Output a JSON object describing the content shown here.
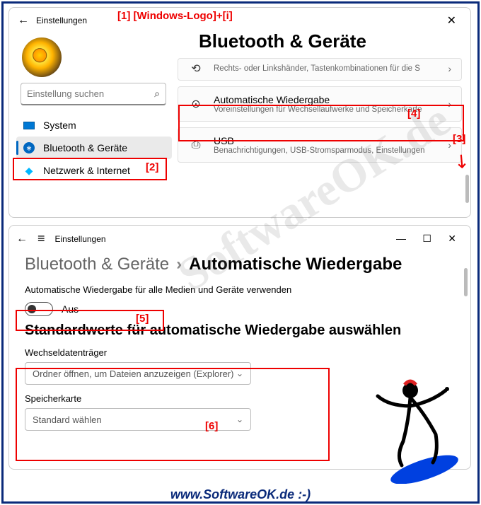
{
  "annot1": "[1]  [Windows-Logo]+[i]",
  "annot2": "[2]",
  "annot3": "[3]",
  "annot4": "[4]",
  "annot5": "[5]",
  "annot6": "[6]",
  "watermark": "SoftwareOK.de",
  "footer": "www.SoftwareOK.de :-)",
  "win1": {
    "back": "←",
    "title": "Einstellungen",
    "close": "✕",
    "pageTitle": "Bluetooth & Geräte",
    "searchPlaceholder": "Einstellung suchen",
    "nav": {
      "system": "System",
      "bt": "Bluetooth & Geräte",
      "net": "Netzwerk & Internet"
    },
    "cards": {
      "c0sub": "Rechts- oder Linkshänder, Tastenkombinationen für die S",
      "c1title": "Automatische Wiedergabe",
      "c1sub": "Voreinstellungen für Wechsellaufwerke und Speicherkarte",
      "c2title": "USB",
      "c2sub": "Benachrichtigungen, USB-Stromsparmodus, Einstellungen"
    }
  },
  "win2": {
    "back": "←",
    "menu": "≡",
    "title": "Einstellungen",
    "bc1": "Bluetooth & Geräte",
    "bcsep": "›",
    "bc2": "Automatische Wiedergabe",
    "sub1": "Automatische Wiedergabe für alle Medien und Geräte verwenden",
    "toggleLabel": "Aus",
    "heading2": "Standardwerte für automatische Wiedergabe auswählen",
    "field1": "Wechseldatenträger",
    "dd1": "Ordner öffnen, um Dateien anzuzeigen (Explorer)",
    "field2": "Speicherkarte",
    "dd2": "Standard wählen"
  }
}
